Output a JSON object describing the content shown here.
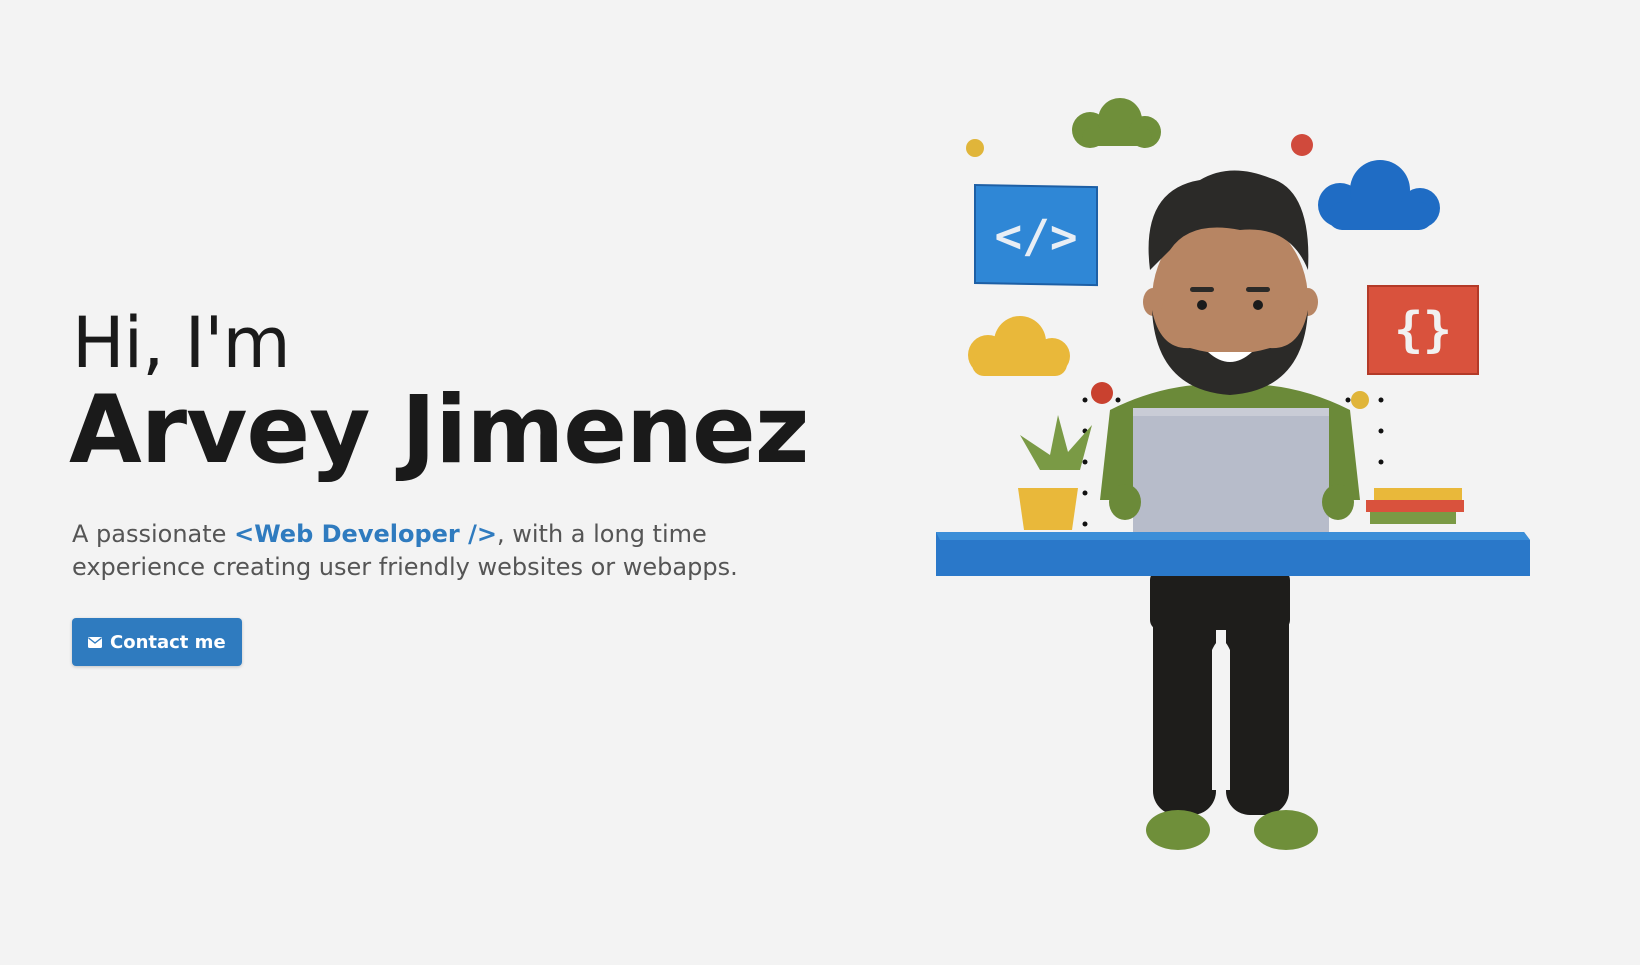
{
  "hero": {
    "greeting": "Hi, I'm",
    "name": "Arvey Jimenez",
    "tagline_prefix": "A passionate ",
    "tagline_highlight": "<Web Developer />",
    "tagline_suffix": ", with a long time experience creating user friendly websites or webapps.",
    "button_label": "Contact me",
    "button_icon": "envelope-icon"
  },
  "illustration": {
    "code_icon_text": "</>",
    "braces_icon_text": "{}"
  },
  "colors": {
    "background": "#f3f3f3",
    "accent": "#2f7bbf",
    "text": "#1a1a1a",
    "muted": "#555555"
  }
}
